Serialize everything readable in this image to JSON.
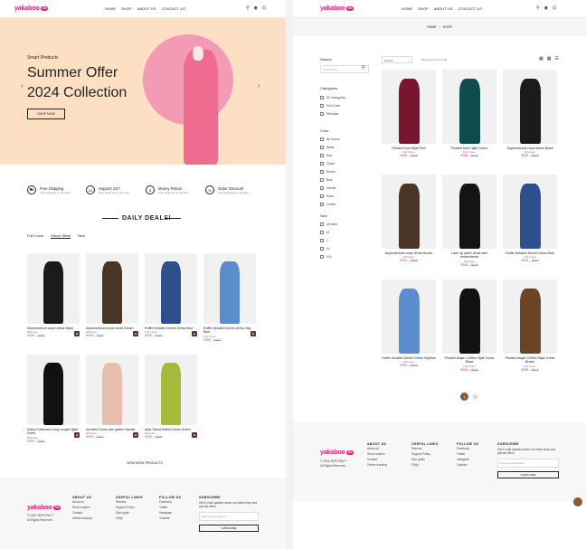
{
  "brand": {
    "logo_text": "yakaboo",
    "badge": "On"
  },
  "nav": {
    "home": "HOME",
    "shop": "SHOP",
    "about": "ABOUT US",
    "contact": "CONTACT US",
    "cart_count": "0"
  },
  "hero": {
    "kicker": "Smart Products",
    "title1": "Summer Offer",
    "title2": "2024 Collection",
    "cta": "SHOP NOW"
  },
  "features": [
    {
      "icon": "truck-icon",
      "title": "Free Shipping",
      "sub": "Free shipping on all order"
    },
    {
      "icon": "support-icon",
      "title": "Support 24/7",
      "sub": "Free shipping on all order"
    },
    {
      "icon": "money-icon",
      "title": "Money Return",
      "sub": "Free shipping on all order"
    },
    {
      "icon": "discount-icon",
      "title": "Order Discount",
      "sub": "Free shipping on all order"
    }
  ],
  "deals": {
    "title": "DAILY DEALS!",
    "tabs": [
      "Full Cover",
      "Ethnic Wear",
      "New"
    ],
    "view_all": "VIEW MORE PRODUCTS"
  },
  "deal_products": [
    {
      "name": "Asymmetrical crepe dress Black",
      "brand": "Ethnique",
      "price": "₹299",
      "old": "₹649",
      "color": "#1b1b1b"
    },
    {
      "name": "Asymmetrical crepe dress Brown",
      "brand": "Ethnique",
      "price": "₹299",
      "old": "₹649",
      "color": "#4a3526"
    },
    {
      "name": "Ruffle Detailed Denim Dress Blue",
      "brand": "Full Cover",
      "price": "₹299",
      "old": "₹649",
      "color": "#2d4f8e"
    },
    {
      "name": "Ruffle Detailed Denim Dress Sky Blue",
      "brand": "Full Cover",
      "price": "₹299",
      "old": "₹649",
      "color": "#5b8ccb"
    },
    {
      "name": "Zebra Patterned Long Length Hijab Dress",
      "brand": "Ethnique",
      "price": "₹299",
      "old": "₹649",
      "color": "#111111"
    },
    {
      "name": "Aurelien Dress with gather Sandle",
      "brand": "Ethnique",
      "price": "₹299",
      "old": "₹649",
      "color": "#e8bfae"
    },
    {
      "name": "Aida Tunna Belted Dress Green",
      "brand": "Ethnique",
      "price": "₹299",
      "old": "₹649",
      "color": "#a6b93a"
    }
  ],
  "footer": {
    "copyright": "© 2024 ZEPHYRA™",
    "rights": "All Rights Reserved",
    "about_title": "ABOUT US",
    "about_links": [
      "About us",
      "Store location",
      "Contact",
      "Orders tracking"
    ],
    "useful_title": "USEFUL LINKS",
    "useful_links": [
      "Returns",
      "Support Policy",
      "Size guide",
      "FAQs"
    ],
    "follow_title": "FOLLOW US",
    "follow_links": [
      "Facebook",
      "Twitter",
      "Instagram",
      "Youtube"
    ],
    "subscribe_title": "SUBSCRIBE",
    "subscribe_text": "Get E-mail updates about our latest shop and special offers.",
    "email_placeholder": "Enter Email Address",
    "subscribe_btn": "SUBSCRIBE"
  },
  "shop": {
    "breadcrumb_home": "HOME",
    "breadcrumb_sep": "/",
    "breadcrumb_current": "SHOP",
    "search_title": "Search",
    "search_placeholder": "Search here...",
    "category_title": "Categories",
    "categories": [
      "All Categories",
      "Full Cover",
      "Ethnique"
    ],
    "color_title": "Color",
    "colors": [
      "All Colors",
      "Black",
      "Red",
      "Green",
      "Brown",
      "Blue",
      "Sandle",
      "Rose",
      "Cream"
    ],
    "size_title": "Size",
    "sizes": [
      "all sizes",
      "M",
      "L",
      "XL",
      "XXL"
    ],
    "sort_label": "Default",
    "showing": "Showing 9 of 9 result",
    "pages": [
      "1",
      "2"
    ]
  },
  "shop_products": [
    {
      "name": "Pleated front Hijab Red",
      "brand": "Full Cover",
      "price": "₹299",
      "old": "₹649",
      "color": "#7a1530"
    },
    {
      "name": "Pleated front Hijab Green",
      "brand": "Full Cover",
      "price": "₹299",
      "old": "₹649",
      "color": "#0f4d4c"
    },
    {
      "name": "Asymmetrical crepe dress Black",
      "brand": "Ethnique",
      "price": "₹299",
      "old": "₹649",
      "color": "#1b1b1b"
    },
    {
      "name": "Asymmetrical crepe dress Brown",
      "brand": "Ethnique",
      "price": "₹299",
      "old": "₹649",
      "color": "#4a3526"
    },
    {
      "name": "Lace up panel dress with embroidered",
      "brand": "Ethnique",
      "price": "₹249",
      "old": "₹649",
      "color": "#141414"
    },
    {
      "name": "Ruffle Detailed Denim Dress Blue",
      "brand": "Full Cover",
      "price": "₹299",
      "old": "₹649",
      "color": "#2d4f8e"
    },
    {
      "name": "Ruffle Detailed Denim Dress SkyBlue",
      "brand": "Ethnique",
      "price": "₹299",
      "old": "₹649",
      "color": "#5b8ccb"
    },
    {
      "name": "Pleated tanjan Chiffon Hijab Dress Black",
      "brand": "Full Cover",
      "price": "₹249",
      "old": "₹649",
      "color": "#111111"
    },
    {
      "name": "Pleated tanjan Chiffon Hijab Dress Brown",
      "brand": "Full Cover",
      "price": "₹299",
      "old": "₹649",
      "color": "#6b4325"
    }
  ]
}
